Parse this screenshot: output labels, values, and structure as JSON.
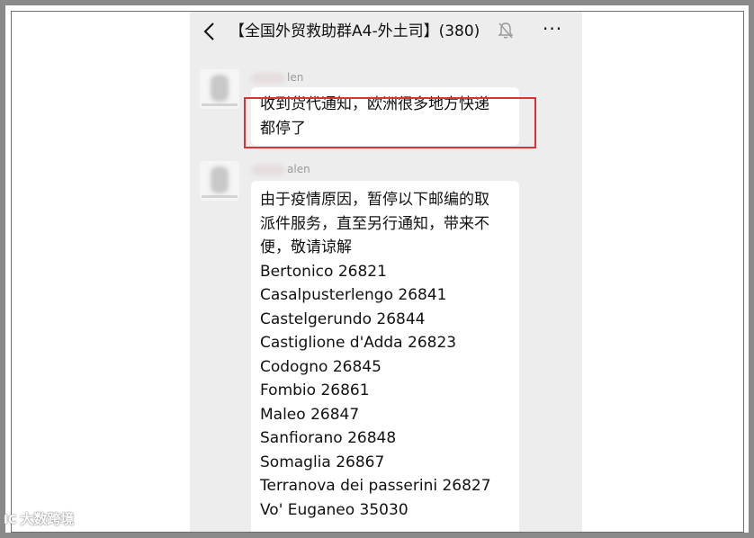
{
  "header": {
    "title": "【全国外贸救助群A4-外土司】(380)",
    "back_icon": "chevron-left-icon",
    "mute_icon": "bell-muted-icon",
    "more_icon": "more-dots-icon",
    "more_glyph": "···"
  },
  "messages": [
    {
      "sender_suffix": "len",
      "lines": [
        "收到货代通知，欧洲很多地方快递",
        "都停了"
      ]
    },
    {
      "sender_suffix": "alen",
      "lines": [
        "由于疫情原因，暂停以下邮编的取",
        "派件服务，直至另行通知，带来不",
        "便，敬请谅解",
        "Bertonico 26821",
        "Casalpusterlengo 26841",
        "Castelgerundo 26844",
        "Castiglione d'Adda 26823",
        "Codogno 26845",
        "Fombio 26861",
        "Maleo 26847",
        "Sanfiorano 26848",
        "Somaglia 26867",
        "Terranova dei passerini 26827",
        "Vo' Euganeo 35030"
      ]
    }
  ],
  "watermark": "大数跨境",
  "colors": {
    "chat_background": "#ededed",
    "bubble": "#ffffff",
    "highlight_border": "#e03030",
    "frame": "#8a8a8a"
  }
}
